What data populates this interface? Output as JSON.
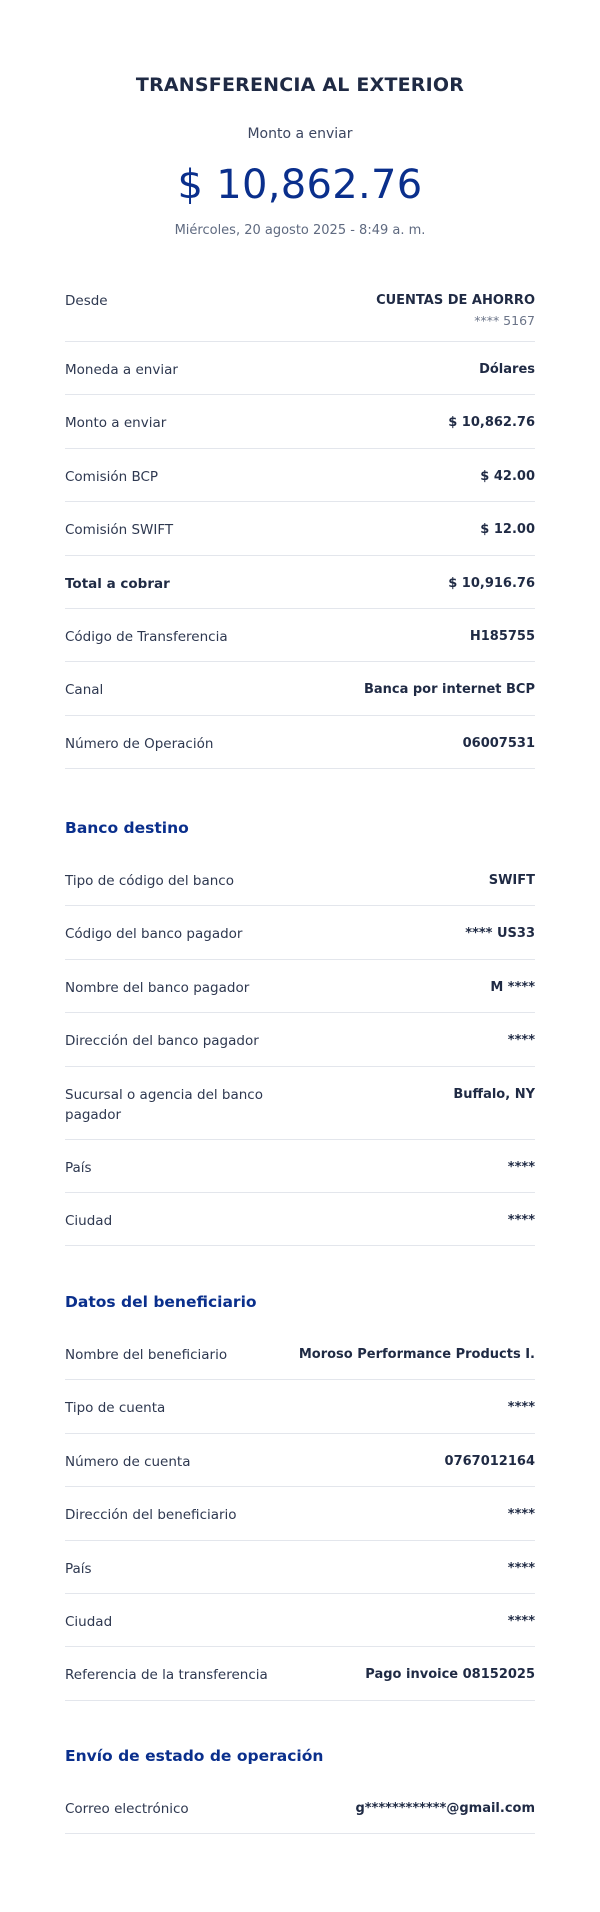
{
  "header": {
    "title": "TRANSFERENCIA AL EXTERIOR",
    "amount_label": "Monto a enviar",
    "amount": "$ 10,862.76",
    "date": "Miércoles, 20 agosto 2025 - 8:49 a. m."
  },
  "summary": {
    "from_label": "Desde",
    "from_value": "CUENTAS DE AHORRO",
    "from_account": "**** 5167",
    "rows": [
      {
        "label": "Moneda a enviar",
        "value": "Dólares"
      },
      {
        "label": "Monto a enviar",
        "value": "$ 10,862.76"
      },
      {
        "label": "Comisión BCP",
        "value": "$ 42.00"
      },
      {
        "label": "Comisión SWIFT",
        "value": "$ 12.00"
      },
      {
        "label": "Total a cobrar",
        "value": "$ 10,916.76"
      },
      {
        "label": "Código de Transferencia",
        "value": "H185755"
      },
      {
        "label": "Canal",
        "value": "Banca por internet  BCP"
      },
      {
        "label": "Número de Operación",
        "value": "06007531"
      }
    ]
  },
  "bank": {
    "title": "Banco destino",
    "rows": [
      {
        "label": "Tipo de código del banco",
        "value": "SWIFT"
      },
      {
        "label": "Código del banco pagador",
        "value": "**** US33"
      },
      {
        "label": "Nombre del banco pagador",
        "value": "M ****"
      },
      {
        "label": "Dirección del banco pagador",
        "value": "****"
      },
      {
        "label": "Sucursal o agencia del banco pagador",
        "value": "Buffalo, NY"
      },
      {
        "label": "País",
        "value": "****"
      },
      {
        "label": "Ciudad",
        "value": "****"
      }
    ]
  },
  "beneficiary": {
    "title": "Datos del beneficiario",
    "rows": [
      {
        "label": "Nombre del beneficiario",
        "value": "Moroso Performance Products I."
      },
      {
        "label": "Tipo de cuenta",
        "value": "****"
      },
      {
        "label": "Número de cuenta",
        "value": "0767012164"
      },
      {
        "label": "Dirección del beneficiario",
        "value": "****"
      },
      {
        "label": "País",
        "value": "****"
      },
      {
        "label": "Ciudad",
        "value": "****"
      },
      {
        "label": "Referencia de la transferencia",
        "value": "Pago invoice 08152025"
      }
    ]
  },
  "notification": {
    "title": "Envío de estado de operación",
    "rows": [
      {
        "label": "Correo electrónico",
        "value": "g************@gmail.com"
      }
    ]
  }
}
